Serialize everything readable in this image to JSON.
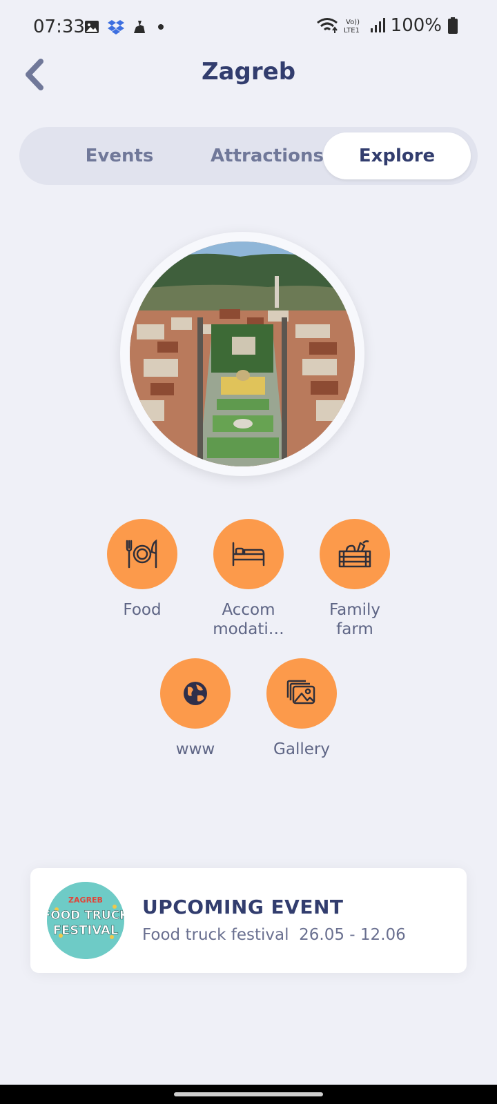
{
  "status": {
    "time": "07:33",
    "battery": "100%",
    "icons": [
      "image-icon",
      "dropbox-icon",
      "app-icon",
      "dot-icon",
      "wifi-icon",
      "volte-icon",
      "signal-icon",
      "battery-icon"
    ]
  },
  "header": {
    "title": "Zagreb",
    "back_icon": "chevron-left-icon"
  },
  "tabs": [
    {
      "label": "Events",
      "active": false
    },
    {
      "label": "Attractions",
      "active": false
    },
    {
      "label": "Explore",
      "active": true
    }
  ],
  "categories": [
    {
      "label": "Food",
      "icon": "plate-cutlery-icon"
    },
    {
      "label": "Accom modati…",
      "icon": "bed-icon"
    },
    {
      "label": "Family farm",
      "icon": "produce-crate-icon"
    },
    {
      "label": "www",
      "icon": "globe-icon"
    },
    {
      "label": "Gallery",
      "icon": "gallery-icon"
    }
  ],
  "event": {
    "heading": "UPCOMING EVENT",
    "name": "Food truck festival",
    "dates": "26.05 - 12.06",
    "logo_text": [
      "ZAGREB",
      "FOOD TRUCK",
      "FESTIVAL"
    ]
  },
  "colors": {
    "background": "#eff0f7",
    "accent_orange": "#fc9a4b",
    "title_navy": "#323d6e",
    "logo_teal": "#6ecbc6"
  }
}
